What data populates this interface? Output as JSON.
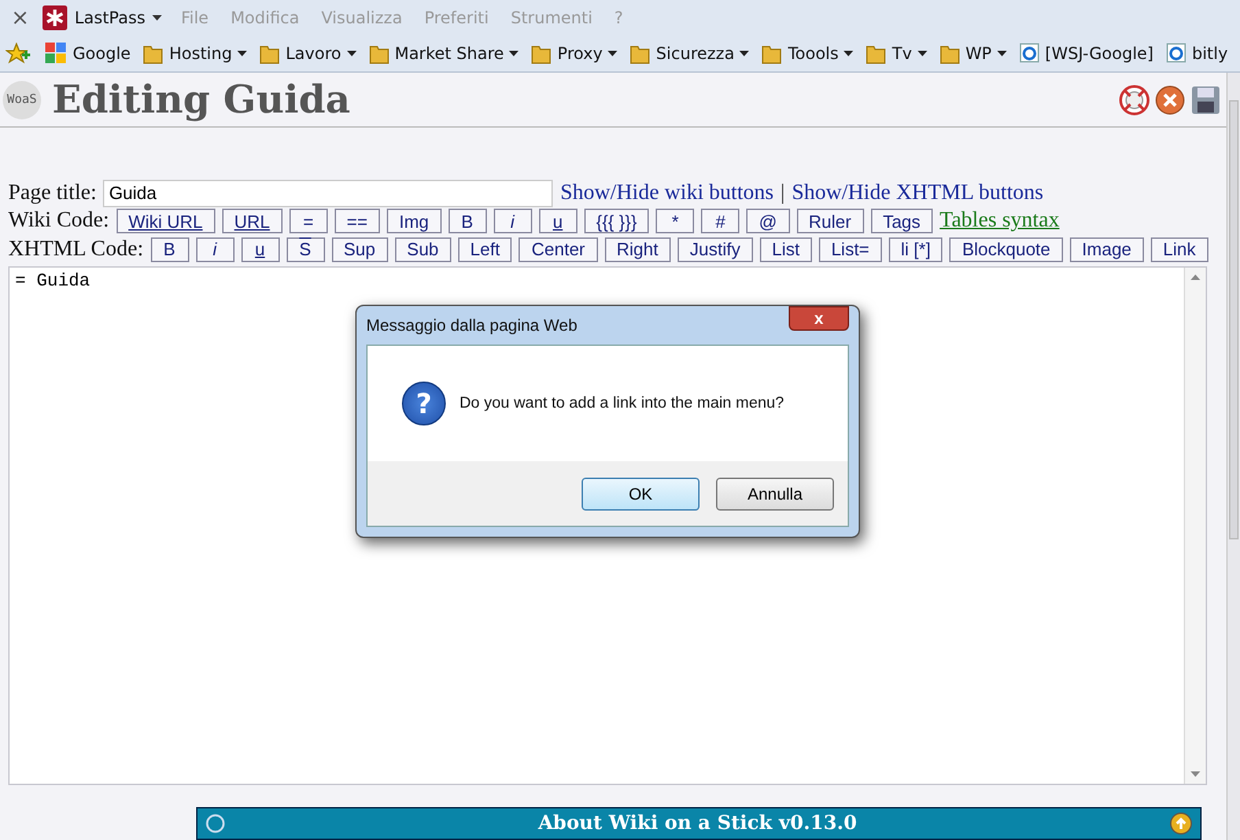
{
  "menubar": {
    "close": "×",
    "brand": "LastPass",
    "items": [
      "File",
      "Modifica",
      "Visualizza",
      "Preferiti",
      "Strumenti",
      "?"
    ]
  },
  "bookmarks": [
    {
      "label": "Google",
      "kind": "site",
      "menu": false
    },
    {
      "label": "Hosting",
      "kind": "folder",
      "menu": true
    },
    {
      "label": "Lavoro",
      "kind": "folder",
      "menu": true
    },
    {
      "label": "Market Share",
      "kind": "folder",
      "menu": true
    },
    {
      "label": "Proxy",
      "kind": "folder",
      "menu": true
    },
    {
      "label": "Sicurezza",
      "kind": "folder",
      "menu": true
    },
    {
      "label": "Toools",
      "kind": "folder",
      "menu": true
    },
    {
      "label": "Tv",
      "kind": "folder",
      "menu": true
    },
    {
      "label": "WP",
      "kind": "folder",
      "menu": true
    },
    {
      "label": "[WSJ-Google]",
      "kind": "page",
      "menu": false
    },
    {
      "label": "bitly",
      "kind": "page",
      "menu": false
    }
  ],
  "header": {
    "logo": "WoaS",
    "title": "Editing Guida"
  },
  "form": {
    "page_title_label": "Page title:",
    "page_title_value": "Guida",
    "links": [
      "Show/Hide wiki buttons",
      "Show/Hide XHTML buttons"
    ],
    "separator": "|",
    "wiki_label": "Wiki Code:",
    "wiki_buttons": [
      {
        "label": "Wiki URL",
        "kind": "underline"
      },
      {
        "label": "URL",
        "kind": "underline"
      },
      {
        "label": "=",
        "kind": "plain"
      },
      {
        "label": "==",
        "kind": "plain"
      },
      {
        "label": "Img",
        "kind": "plain"
      },
      {
        "label": "B",
        "kind": "plain"
      },
      {
        "label": "i",
        "kind": "italic"
      },
      {
        "label": "u",
        "kind": "underline"
      },
      {
        "label": "{{{ }}}",
        "kind": "plain"
      },
      {
        "label": "*",
        "kind": "plain"
      },
      {
        "label": "#",
        "kind": "plain"
      },
      {
        "label": "@",
        "kind": "plain"
      },
      {
        "label": "Ruler",
        "kind": "plain"
      },
      {
        "label": "Tags",
        "kind": "plain"
      }
    ],
    "tables_link": "Tables syntax",
    "xhtml_label": "XHTML Code:",
    "xhtml_buttons": [
      {
        "label": "B",
        "kind": "plain"
      },
      {
        "label": "i",
        "kind": "italic"
      },
      {
        "label": "u",
        "kind": "underline"
      },
      {
        "label": "S",
        "kind": "overline"
      },
      {
        "label": "Sup",
        "kind": "plain"
      },
      {
        "label": "Sub",
        "kind": "plain"
      },
      {
        "label": "Left",
        "kind": "plain"
      },
      {
        "label": "Center",
        "kind": "plain"
      },
      {
        "label": "Right",
        "kind": "plain"
      },
      {
        "label": "Justify",
        "kind": "plain"
      },
      {
        "label": "List",
        "kind": "plain"
      },
      {
        "label": "List=",
        "kind": "plain"
      },
      {
        "label": "li [*]",
        "kind": "plain"
      },
      {
        "label": "Blockquote",
        "kind": "plain"
      },
      {
        "label": "Image",
        "kind": "plain"
      },
      {
        "label": "Link",
        "kind": "plain"
      }
    ],
    "editor_text": "= Guida"
  },
  "dialog": {
    "title": "Messaggio dalla pagina Web",
    "close": "x",
    "icon": "?",
    "message": "Do you want to add a link into the main menu?",
    "buttons": [
      {
        "label": "OK",
        "selected": true
      },
      {
        "label": "Annulla",
        "selected": false
      }
    ]
  },
  "footer": {
    "title": "About Wiki on a Stick v0.13.0"
  }
}
